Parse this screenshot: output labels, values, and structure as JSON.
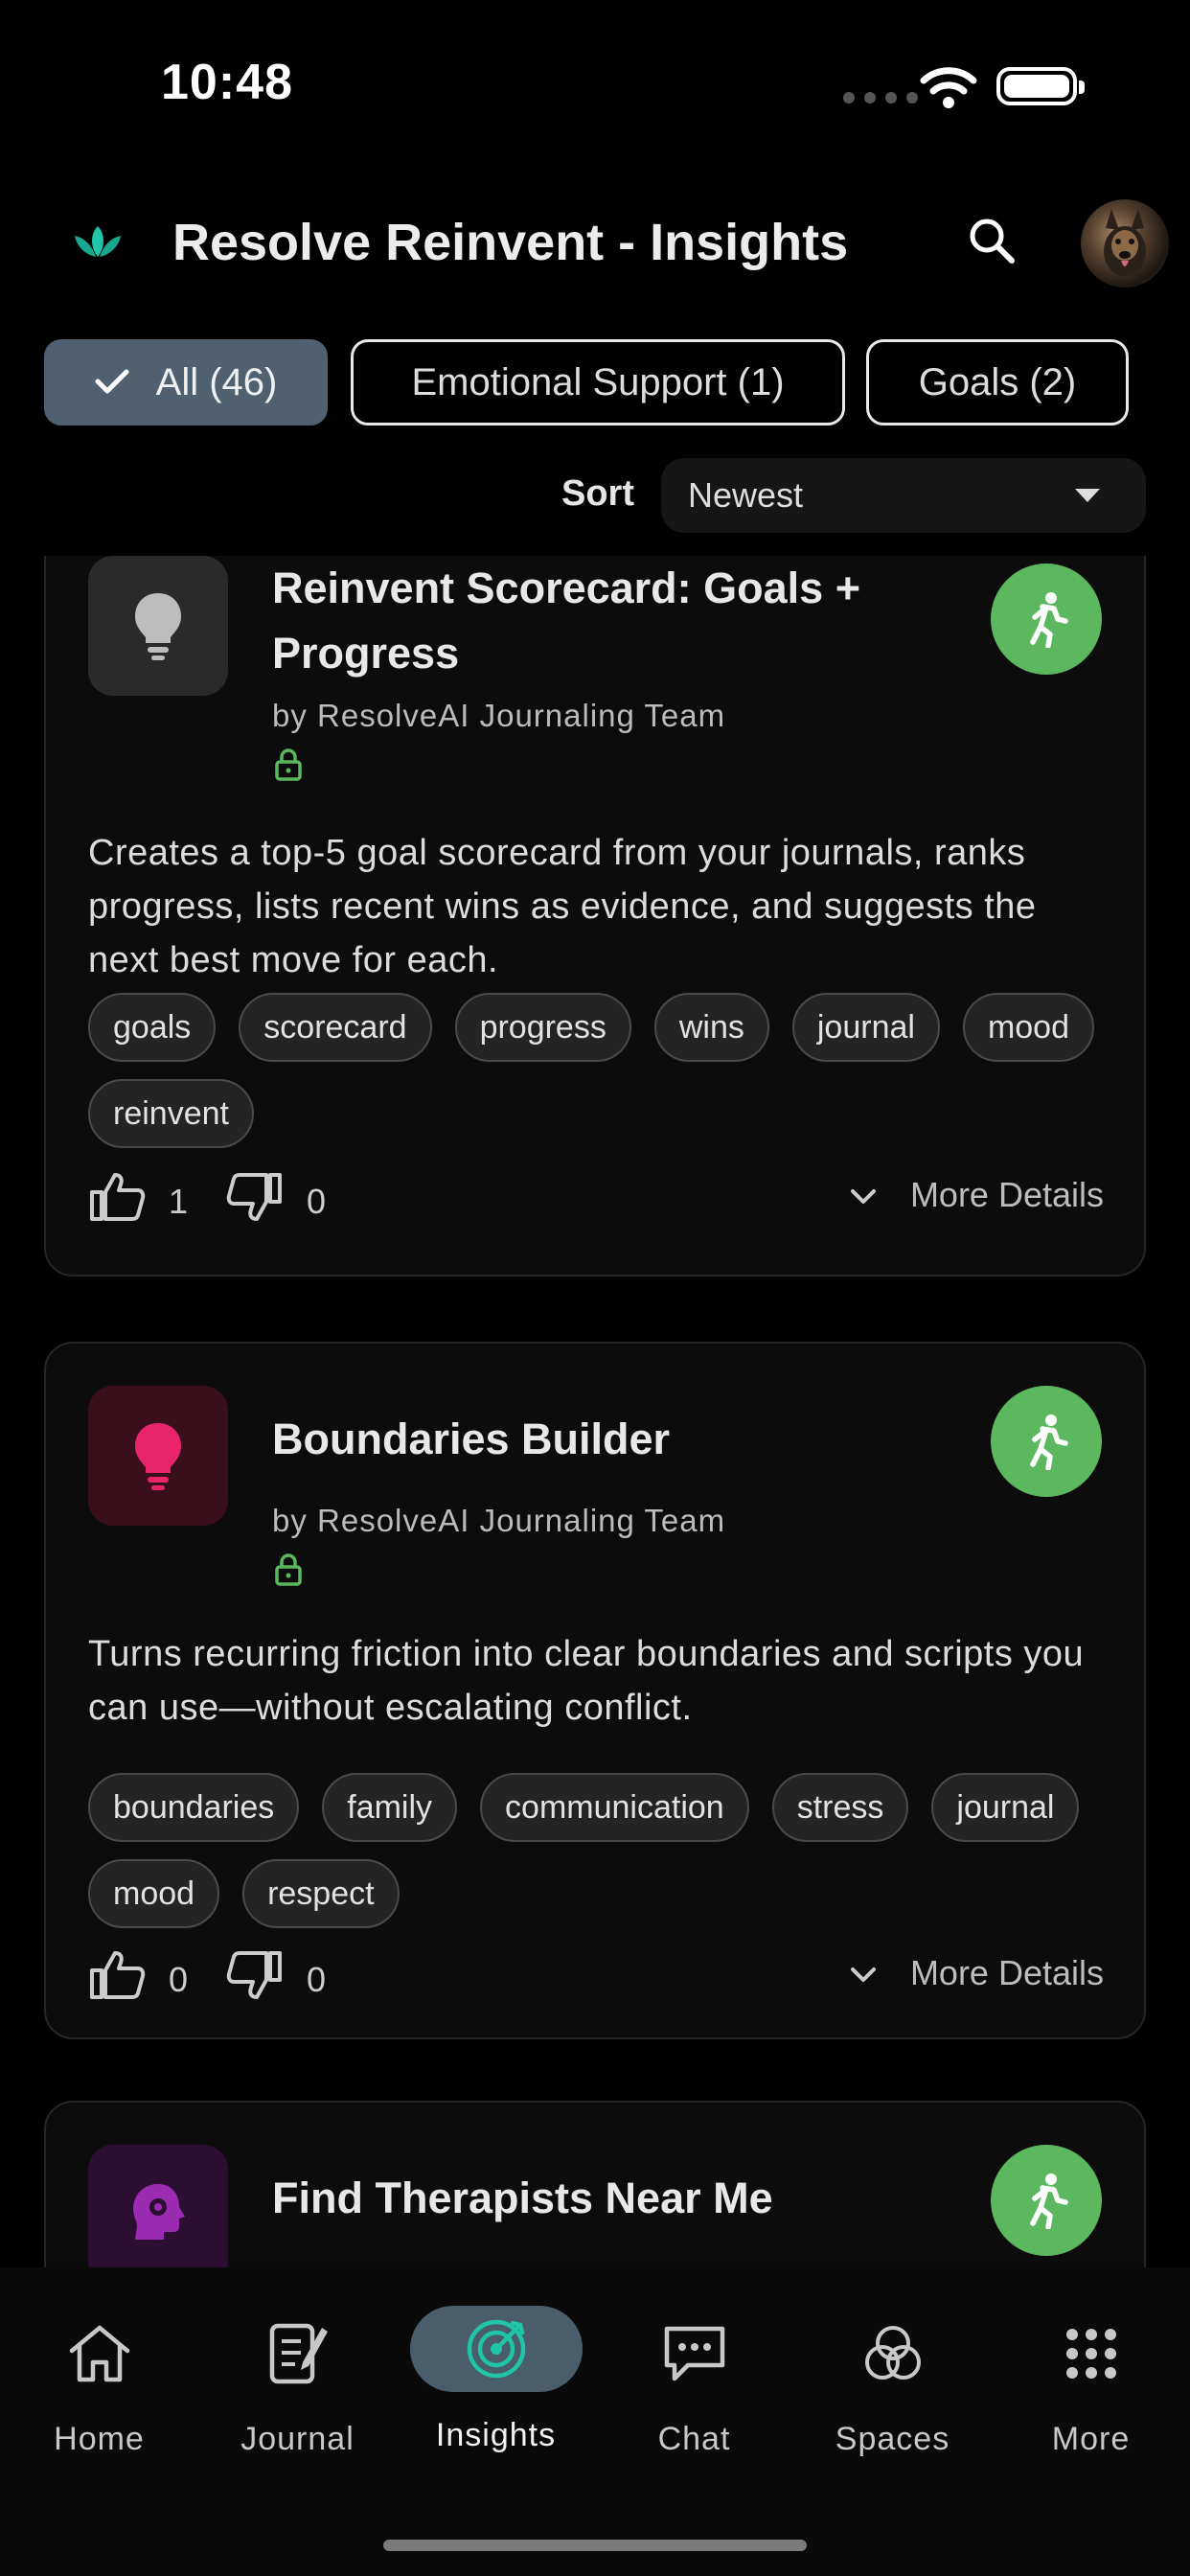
{
  "status_bar": {
    "time": "10:48"
  },
  "header": {
    "title": "Resolve Reinvent - Insights"
  },
  "filters": [
    {
      "label": "All (46)",
      "active": true
    },
    {
      "label": "Emotional Support (1)",
      "active": false
    },
    {
      "label": "Goals (2)",
      "active": false
    }
  ],
  "sort": {
    "label": "Sort",
    "value": "Newest"
  },
  "cards": [
    {
      "title_line1": "Reinvent Scorecard: Goals +",
      "title_line2": "Progress",
      "author": "by ResolveAI Journaling Team",
      "description": "Creates a top-5 goal scorecard from your journals, ranks progress, lists recent wins as evidence, and suggests the next best move for each.",
      "tags": [
        "goals",
        "scorecard",
        "progress",
        "wins",
        "journal",
        "mood",
        "reinvent"
      ],
      "likes": "1",
      "dislikes": "0",
      "more_label": "More Details",
      "icon": "lightbulb-icon",
      "icon_color": "#bdbdbd",
      "tile_color": "#2a2a2a"
    },
    {
      "title_line1": "Boundaries Builder",
      "author": "by ResolveAI Journaling Team",
      "description": "Turns recurring friction into clear boundaries and scripts you can use—without escalating conflict.",
      "tags": [
        "boundaries",
        "family",
        "communication",
        "stress",
        "journal",
        "mood",
        "respect"
      ],
      "likes": "0",
      "dislikes": "0",
      "more_label": "More Details",
      "icon": "lightbulb-icon",
      "icon_color": "#e8246b",
      "tile_color": "#3a0f1c"
    },
    {
      "title_line1": "Find Therapists Near Me",
      "icon": "head-gear-icon",
      "icon_color": "#9b2bb0",
      "tile_color": "#2c0e33"
    }
  ],
  "nav": [
    {
      "label": "Home",
      "icon": "home-icon"
    },
    {
      "label": "Journal",
      "icon": "journal-icon"
    },
    {
      "label": "Insights",
      "icon": "target-icon",
      "active": true
    },
    {
      "label": "Chat",
      "icon": "chat-icon"
    },
    {
      "label": "Spaces",
      "icon": "spaces-icon"
    },
    {
      "label": "More",
      "icon": "grid-icon"
    }
  ],
  "colors": {
    "accent_green": "#5cb85f",
    "active_chip": "#4f6170",
    "brand_teal": "#20c4a8"
  }
}
